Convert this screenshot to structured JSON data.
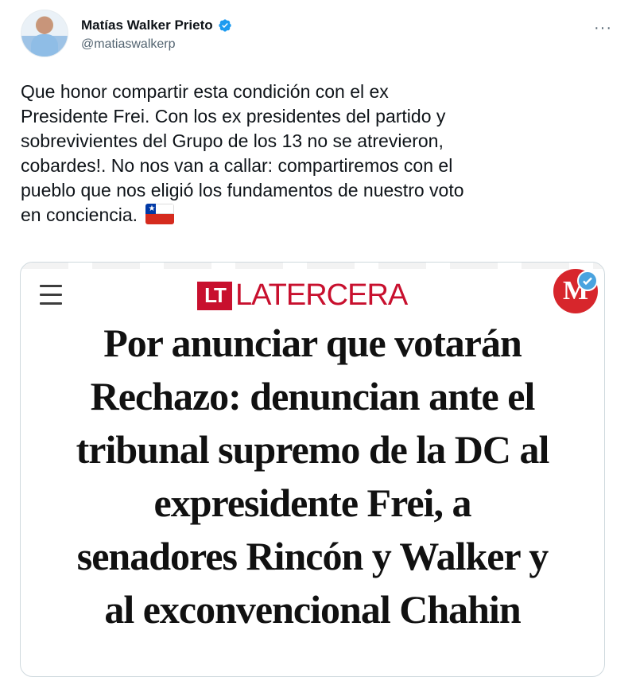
{
  "author": {
    "name": "Matías Walker Prieto",
    "handle": "@matiaswalkerp",
    "verified": true
  },
  "menu_icon": "more-horizontal-icon",
  "tweet_text": "Que honor compartir esta condición con el ex\nPresidente Frei. Con los ex presidentes del partido y\nsobrevivientes del Grupo de los 13 no se atrevieron,\ncobardes!. No nos van a callar: compartiremos con el\npueblo que nos eligió los fundamentos de nuestro voto\nen conciencia.",
  "emoji": "chile-flag",
  "card": {
    "site_logo_mark": "LT",
    "site_name": "LATERCERA",
    "badge_letter": "M",
    "headline_lines": [
      "Por anunciar que votarán",
      "Rechazo: denuncian ante el",
      "tribunal supremo de la DC al",
      "expresidente Frei, a",
      "senadores Rincón y Walker y",
      "al exconvencional Chahin"
    ]
  },
  "colors": {
    "accent": "#1d9bf0",
    "brand_red": "#c8102e",
    "text": "#0f1419",
    "muted": "#536471"
  }
}
